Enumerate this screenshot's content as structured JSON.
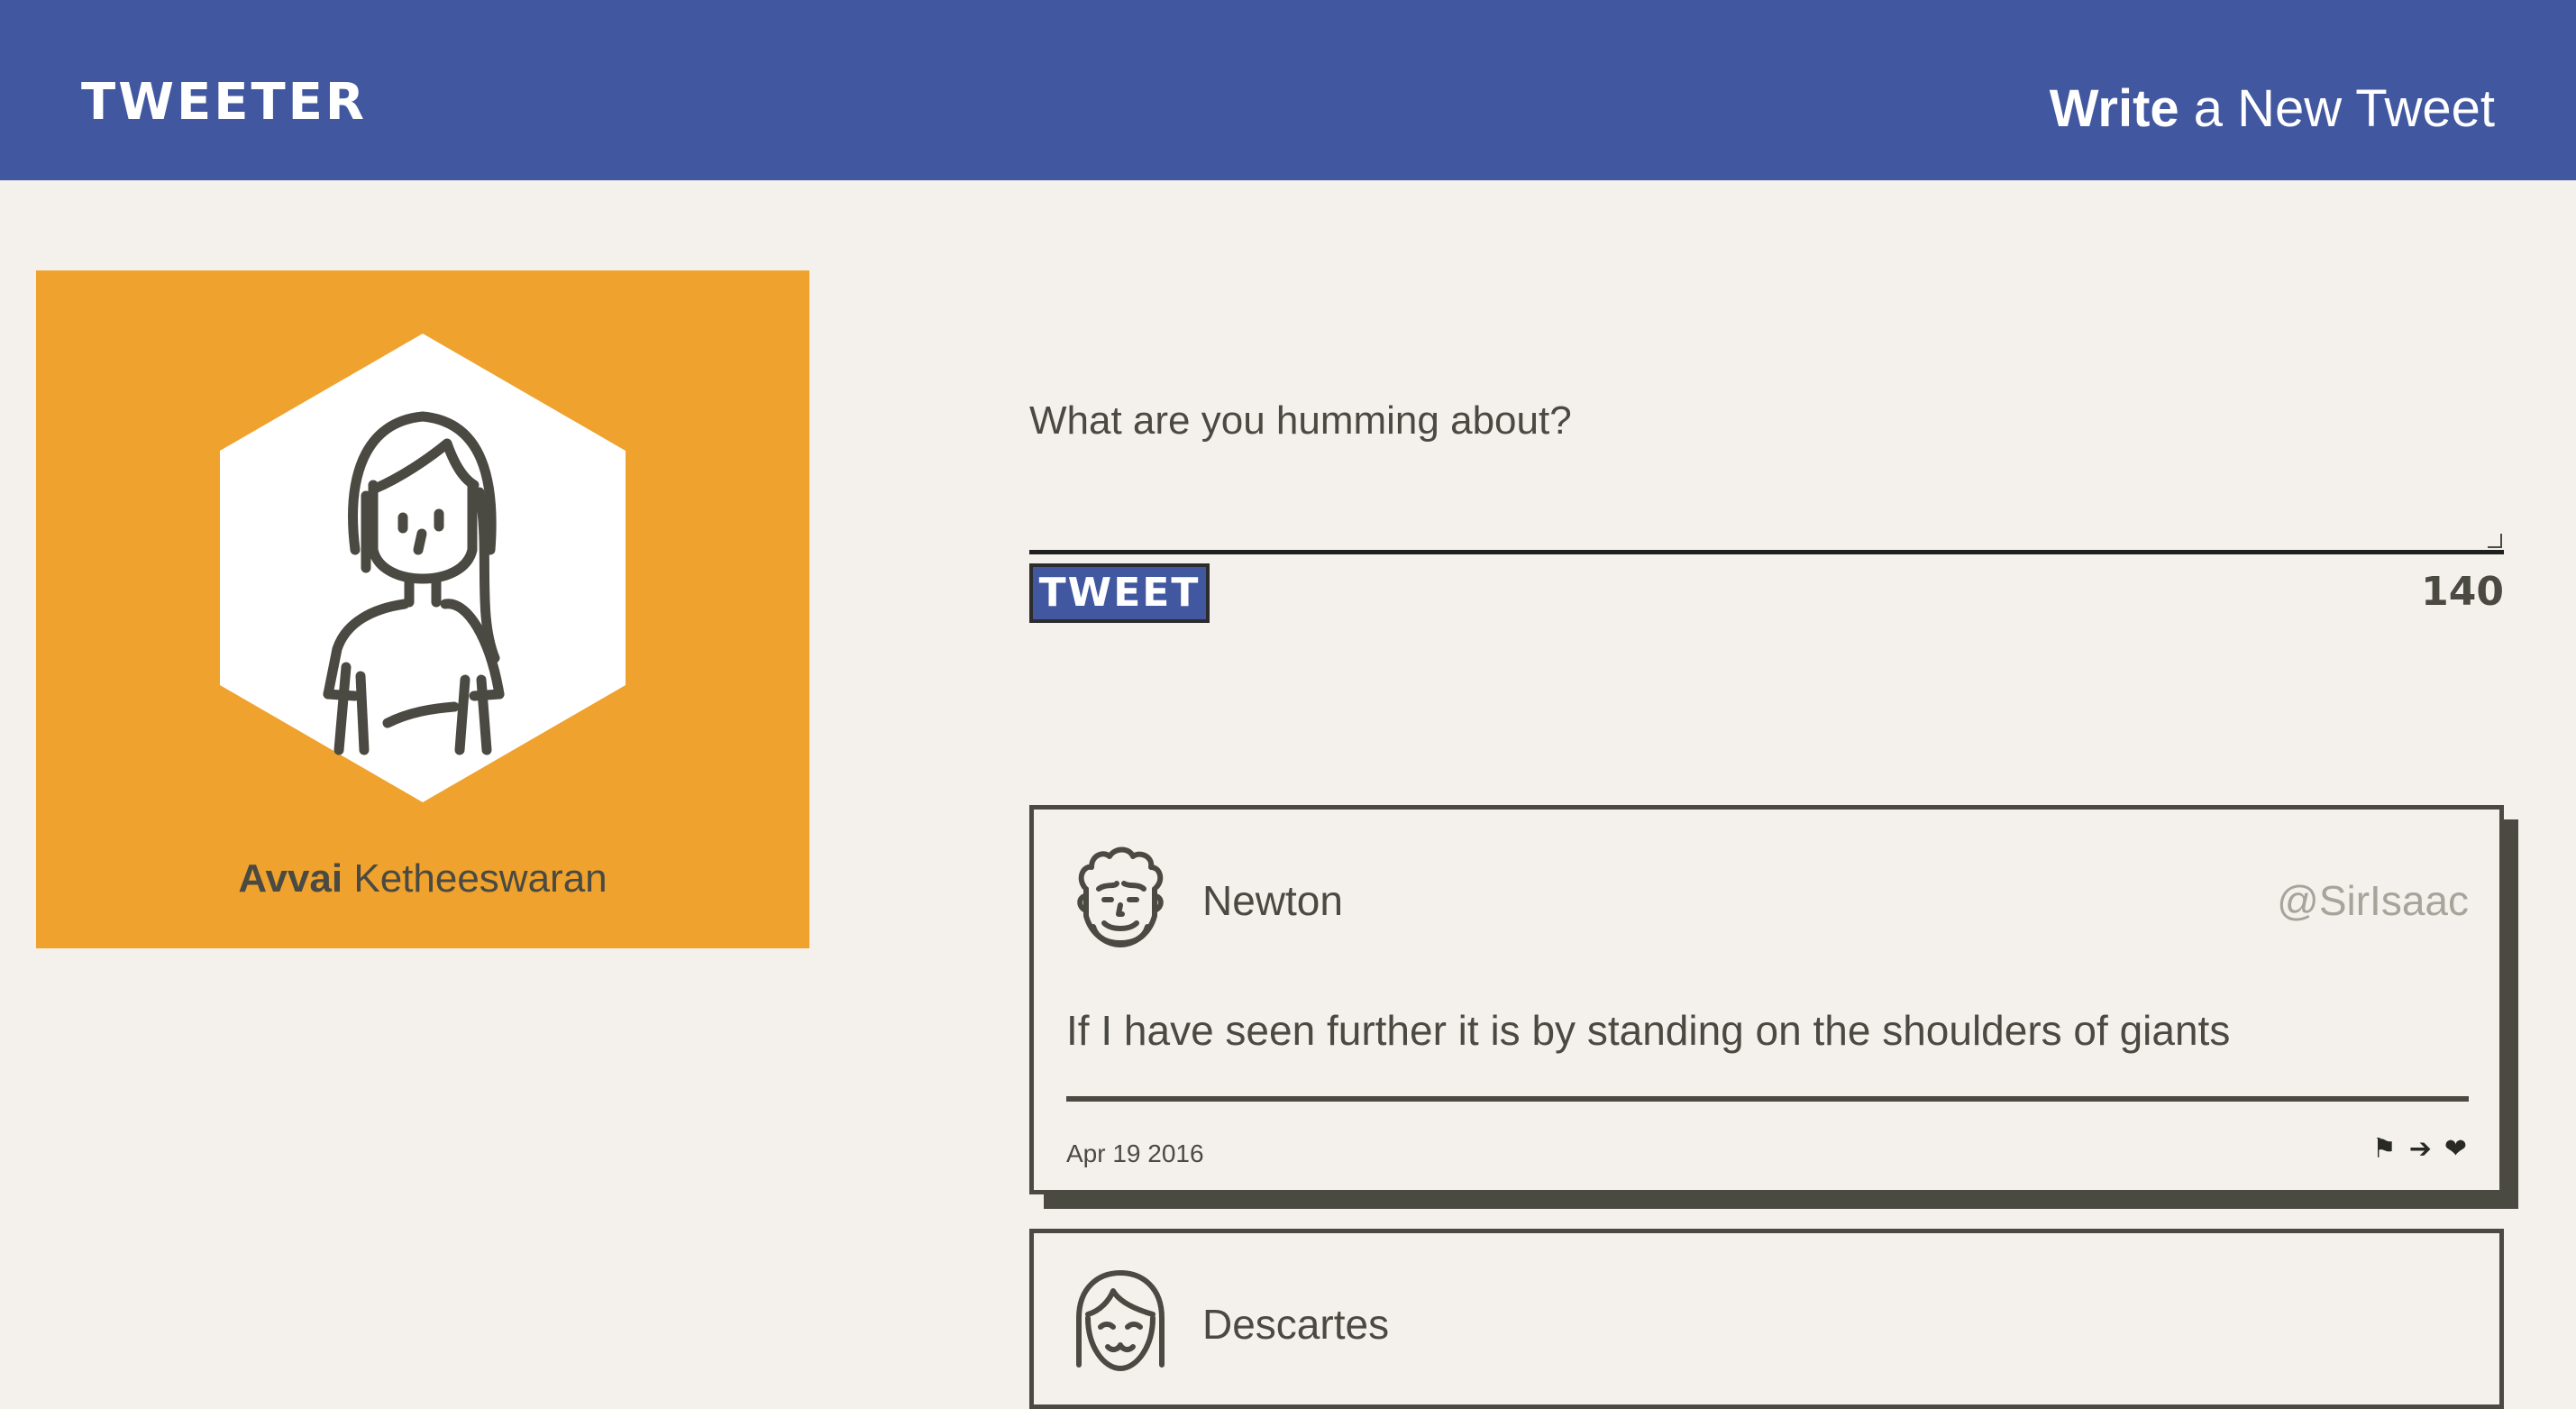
{
  "nav": {
    "logo": "TWEETER",
    "compose_strong": "Write",
    "compose_rest": " a New Tweet"
  },
  "profile": {
    "first_name": "Avvai",
    "last_name": " Ketheeswaran",
    "avatar_icon": "girl-avatar-icon",
    "card_color": "#efa22d"
  },
  "composer": {
    "placeholder": "What are you humming about?",
    "value": "",
    "button_label": "TWEET",
    "counter": "140"
  },
  "tweets": [
    {
      "author": "Newton",
      "handle": "@SirIsaac",
      "text": "If I have seen further it is by standing on the shoulders of giants",
      "date": "Apr 19 2016",
      "avatar_icon": "curly-hair-man-avatar-icon",
      "actions": [
        "flag-icon",
        "retweet-icon",
        "heart-icon"
      ]
    },
    {
      "author": "Descartes",
      "avatar_icon": "bob-hair-avatar-icon"
    }
  ],
  "colors": {
    "nav": "#4157a0",
    "background": "#f4f1ec",
    "text": "#4a4a42",
    "handle": "#a8a49c"
  }
}
